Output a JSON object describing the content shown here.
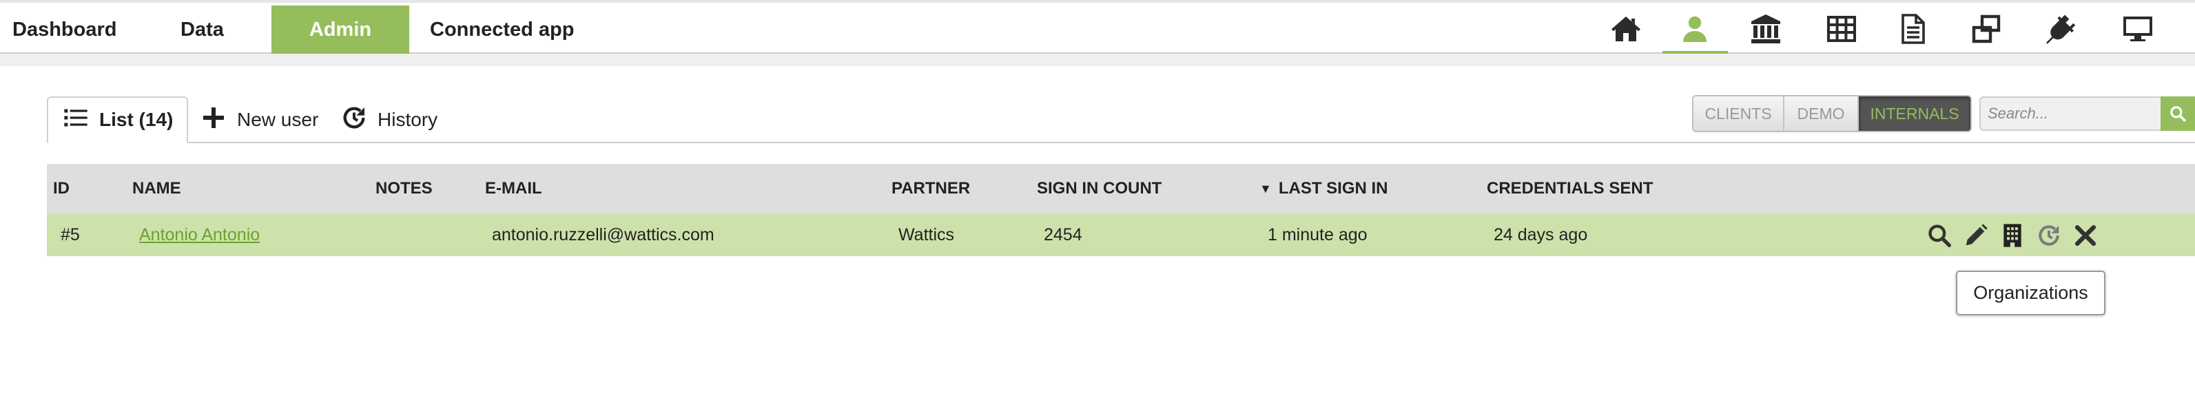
{
  "nav": {
    "items": [
      {
        "label": "Dashboard"
      },
      {
        "label": "Data"
      },
      {
        "label": "Admin",
        "active": true
      },
      {
        "label": "Connected app"
      }
    ],
    "icons": [
      "home-icon",
      "user-icon",
      "bank-icon",
      "table-icon",
      "document-icon",
      "windows-icon",
      "plug-icon",
      "monitor-icon"
    ],
    "active_icon": "user-icon",
    "accent_color": "#95bd5b"
  },
  "tabs": [
    {
      "label": "List (14)",
      "icon": "list-icon",
      "active": true
    },
    {
      "label": "New user",
      "icon": "plus-icon"
    },
    {
      "label": "History",
      "icon": "history-icon"
    }
  ],
  "filters": [
    {
      "label": "CLIENTS"
    },
    {
      "label": "DEMO"
    },
    {
      "label": "INTERNALS",
      "active": true
    }
  ],
  "search": {
    "placeholder": "Search..."
  },
  "table": {
    "columns": [
      "ID",
      "NAME",
      "NOTES",
      "E-MAIL",
      "PARTNER",
      "SIGN IN COUNT",
      "LAST SIGN IN",
      "CREDENTIALS SENT"
    ],
    "sort_indicator": "▼",
    "sorted_column": "LAST SIGN IN",
    "rows": [
      {
        "id": "#5",
        "name": "Antonio Antonio",
        "notes": "",
        "email": "antonio.ruzzelli@wattics.com",
        "partner": "Wattics",
        "sign_in_count": "2454",
        "last_sign_in": "1 minute ago",
        "credentials_sent": "24 days ago",
        "actions": [
          "search-icon",
          "edit-icon",
          "organizations-icon",
          "history-icon",
          "delete-icon"
        ]
      }
    ],
    "row_highlight_color": "#cde2aa"
  },
  "tooltip": {
    "text": "Organizations"
  }
}
